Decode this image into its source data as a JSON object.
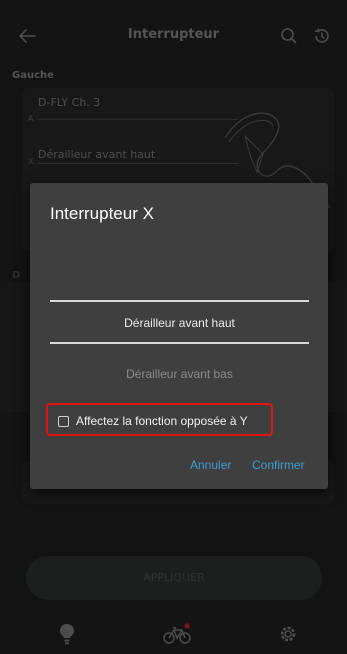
{
  "header": {
    "title": "Interrupteur",
    "back_icon": "arrow-left-icon",
    "search_icon": "search-icon",
    "history_icon": "history-icon"
  },
  "section": {
    "title": "Gauche",
    "rows": [
      {
        "letter": "A",
        "label": "D-FLY Ch. 3"
      },
      {
        "letter": "X",
        "label": "Dérailleur avant haut"
      }
    ]
  },
  "section2": {
    "letter": "D"
  },
  "apply_button": {
    "label": "APPLIQUER"
  },
  "bottom_nav": {
    "items": [
      {
        "icon": "lightbulb-icon"
      },
      {
        "icon": "bicycle-icon"
      },
      {
        "icon": "gear-icon"
      }
    ]
  },
  "dialog": {
    "title": "Interrupteur X",
    "picker": {
      "options": [
        "",
        "Dérailleur avant haut",
        "Dérailleur avant bas"
      ],
      "selected": "Dérailleur avant haut"
    },
    "checkbox": {
      "label": "Affectez la fonction opposée à Y",
      "checked": false
    },
    "cancel_label": "Annuler",
    "confirm_label": "Confirmer"
  },
  "colors": {
    "accent": "#3e9bd2",
    "highlight": "#e01414",
    "dialog_bg": "#3f3f3f",
    "notification_dot": "#e0243a"
  }
}
